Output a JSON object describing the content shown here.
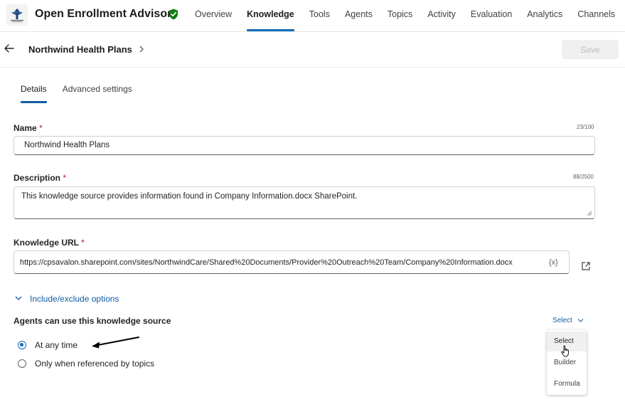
{
  "app": {
    "title": "Open Enrollment Advisor",
    "logo_icon": "northwind-logo",
    "verified_icon": "shield-check-icon"
  },
  "nav": {
    "items": [
      "Overview",
      "Knowledge",
      "Tools",
      "Agents",
      "Topics",
      "Activity",
      "Evaluation",
      "Analytics",
      "Channels"
    ],
    "active": "Knowledge"
  },
  "header": {
    "back_icon": "back-arrow-icon",
    "breadcrumb": "Northwind Health Plans",
    "save_label": "Save"
  },
  "tabs": {
    "items": [
      "Details",
      "Advanced settings"
    ],
    "active": "Details"
  },
  "form": {
    "required_marker": "*",
    "name": {
      "label": "Name",
      "value": "Northwind Health Plans",
      "counter": "23/100"
    },
    "description": {
      "label": "Description",
      "value": "This knowledge source provides information found in Company Information.docx SharePoint.",
      "counter": "88/2500"
    },
    "url": {
      "label": "Knowledge URL",
      "value": "https://cpsavalon.sharepoint.com/sites/NorthwindCare/Shared%20Documents/Provider%20Outreach%20Team/Company%20Information.docx",
      "variable_icon_text": "{x}",
      "open_icon": "open-external-icon"
    },
    "include_exclude": {
      "label": "Include/exclude options"
    },
    "usage": {
      "label": "Agents can use this knowledge source",
      "select_label": "Select",
      "options": [
        {
          "label": "At any time",
          "selected": true
        },
        {
          "label": "Only when referenced by topics",
          "selected": false
        }
      ]
    }
  },
  "dropdown": {
    "items": [
      "Select",
      "Builder",
      "Formula"
    ],
    "hovered": "Select"
  },
  "colors": {
    "accent": "#0f6cbd",
    "link": "#115ea3",
    "verified": "#107c10",
    "required": "#c50f1f"
  }
}
